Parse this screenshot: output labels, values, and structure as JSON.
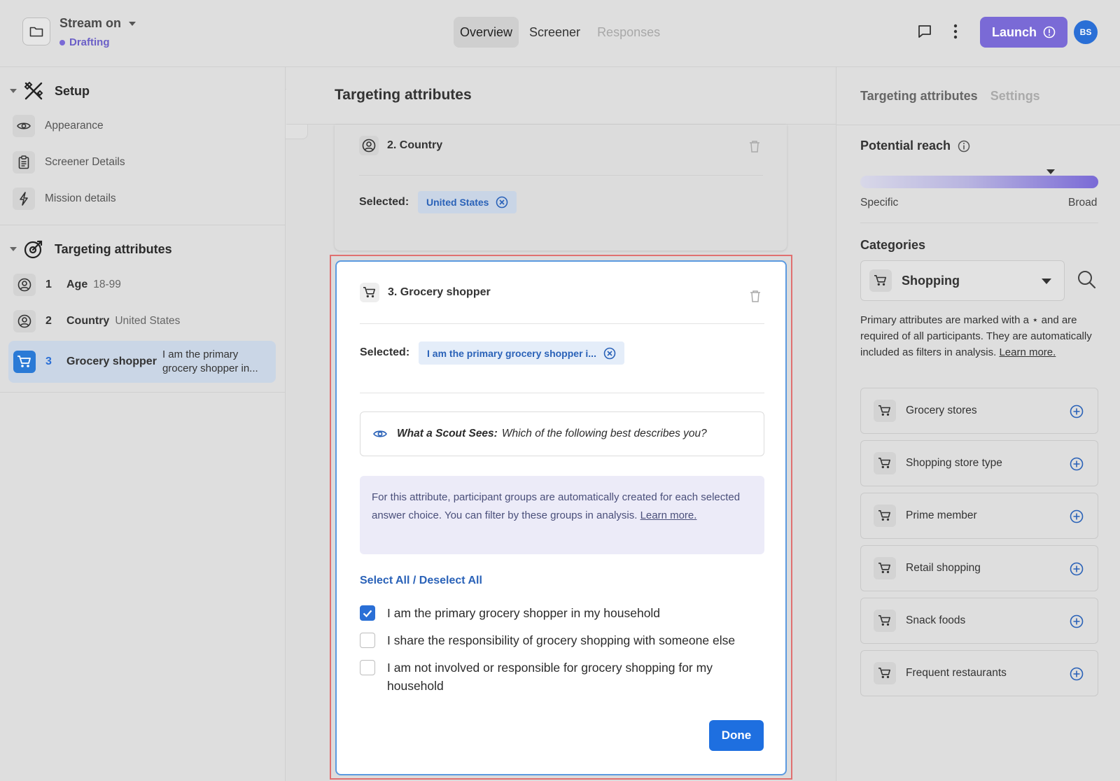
{
  "header": {
    "project_name": "Stream on",
    "status": "Drafting",
    "tabs": [
      {
        "label": "Overview",
        "state": "active"
      },
      {
        "label": "Screener",
        "state": "normal"
      },
      {
        "label": "Responses",
        "state": "disabled"
      }
    ],
    "launch_label": "Launch",
    "avatar_initials": "BS",
    "accent_color": "#7a6ad6"
  },
  "sidebar": {
    "setup": {
      "title": "Setup",
      "items": [
        {
          "label": "Appearance",
          "icon": "eye-icon"
        },
        {
          "label": "Screener Details",
          "icon": "clipboard-icon"
        },
        {
          "label": "Mission details",
          "icon": "lightning-icon"
        }
      ]
    },
    "targeting": {
      "title": "Targeting attributes",
      "items": [
        {
          "num": "1",
          "label": "Age",
          "value": "18-99",
          "icon": "person-badge-icon"
        },
        {
          "num": "2",
          "label": "Country",
          "value": "United States",
          "icon": "person-badge-icon"
        },
        {
          "num": "3",
          "label": "Grocery shopper",
          "value": "I am the primary grocery shopper in...",
          "icon": "cart-icon"
        }
      ]
    }
  },
  "main": {
    "title": "Targeting attributes",
    "country_card": {
      "title": "2. Country",
      "selected_label": "Selected:",
      "chip": "United States"
    },
    "grocery_card": {
      "title": "3. Grocery shopper",
      "selected_label": "Selected:",
      "chip": "I am the primary grocery shopper i...",
      "scout_label": "What a Scout Sees:",
      "scout_question": "Which of the following best describes you?",
      "info_text": "For this attribute, participant groups are automatically created for each selected answer choice. You can filter by these groups in analysis.",
      "info_link": "Learn more.",
      "select_all": "Select All / Deselect All",
      "options": [
        {
          "label": "I am the primary grocery shopper in my household",
          "checked": true
        },
        {
          "label": "I share the responsibility of grocery shopping with someone else",
          "checked": false
        },
        {
          "label": "I am not involved or responsible for grocery shopping for my household",
          "checked": false
        }
      ],
      "done_label": "Done"
    }
  },
  "right": {
    "tabs": [
      "Targeting attributes",
      "Settings"
    ],
    "reach_title": "Potential reach",
    "reach_level": 0.8,
    "reach_min": "Specific",
    "reach_max": "Broad",
    "categories_title": "Categories",
    "category_selected": "Shopping",
    "description": "Primary attributes are marked with a ⋆ and are required of all participants. They are automatically included as filters in analysis.",
    "description_link": "Learn more.",
    "items": [
      "Grocery stores",
      "Shopping store type",
      "Prime member",
      "Retail shopping",
      "Snack foods",
      "Frequent restaurants"
    ]
  }
}
